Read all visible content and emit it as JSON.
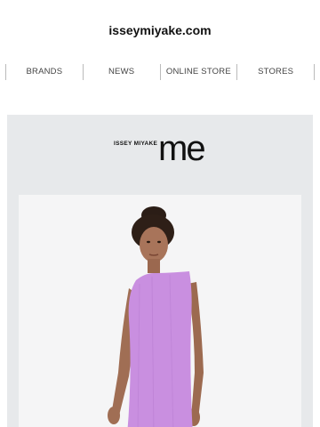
{
  "header": {
    "site_title": "isseymiyake.com"
  },
  "nav": {
    "items": [
      {
        "label": "BRANDS"
      },
      {
        "label": "NEWS"
      },
      {
        "label": "ONLINE STORE"
      },
      {
        "label": "STORES"
      }
    ]
  },
  "banner": {
    "logo": {
      "small_text": "ISSEY MIYAKE",
      "big_text": "me"
    }
  },
  "colors": {
    "banner_background": "#e7e9eb",
    "dress": "#c98fe0"
  }
}
